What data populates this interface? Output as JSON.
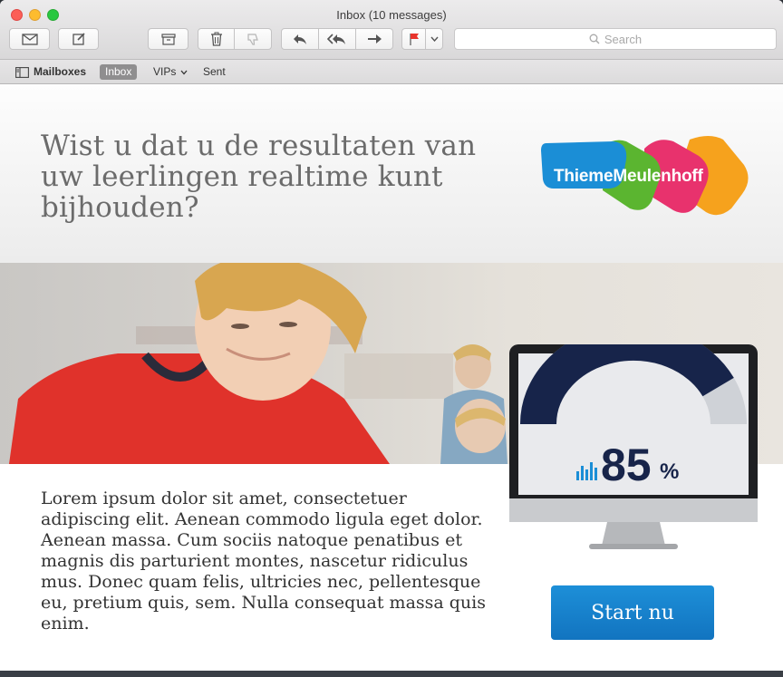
{
  "window": {
    "title": "Inbox (10 messages)"
  },
  "toolbar": {
    "buttons": [
      {
        "name": "get-mail",
        "icon": "envelope-icon"
      },
      {
        "name": "compose",
        "icon": "compose-icon"
      },
      {
        "name": "archive",
        "icon": "archive-icon"
      },
      {
        "name": "trash",
        "icon": "trash-icon"
      },
      {
        "name": "junk",
        "icon": "thumbs-down-icon"
      },
      {
        "name": "reply",
        "icon": "reply-icon"
      },
      {
        "name": "reply-all",
        "icon": "reply-all-icon"
      },
      {
        "name": "forward",
        "icon": "forward-icon"
      },
      {
        "name": "flag",
        "icon": "flag-icon"
      },
      {
        "name": "flag-menu",
        "icon": "chevron-down-icon"
      }
    ],
    "search_placeholder": "Search"
  },
  "favorites": {
    "mailboxes": "Mailboxes",
    "inbox": "Inbox",
    "vips": "VIPs",
    "sent": "Sent"
  },
  "email": {
    "headline": "Wist u dat u de resultaten van uw leerlingen realtime kunt bijhouden?",
    "logo_text": "ThiemeMeulenhoff",
    "gauge_value": "85",
    "gauge_unit": "%",
    "gauge_fraction": 0.85,
    "body": "Lorem ipsum dolor sit amet, consectetuer adipiscing elit. Aenean commodo ligula eget dolor. Aenean massa. Cum sociis natoque penatibus et magnis dis parturient montes, nascetur ridiculus mus. Donec quam felis, ultricies nec, pellentesque eu, pretium quis, sem. Nulla consequat massa quis enim.",
    "cta": "Start nu"
  },
  "colors": {
    "accent": "#1677c7",
    "flag": "#e8342c",
    "gauge_dark": "#17244a",
    "logo_blue": "#1b8ed6",
    "logo_green": "#5bb530",
    "logo_pink": "#e8326d",
    "logo_orange": "#f6a21d"
  }
}
